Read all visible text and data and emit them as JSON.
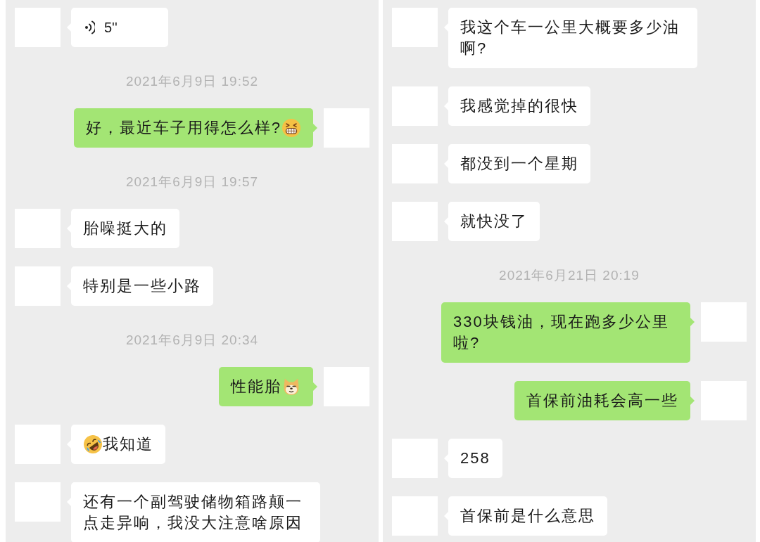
{
  "panels": [
    {
      "messages": [
        {
          "kind": "voice",
          "outgoing": false,
          "duration": "5''"
        },
        {
          "kind": "timestamp",
          "text": "2021年6月9日 19:52"
        },
        {
          "kind": "text",
          "outgoing": true,
          "content": [
            {
              "kind": "text",
              "text": "好，最近车子用得怎么样?"
            },
            {
              "kind": "grin"
            }
          ]
        },
        {
          "kind": "timestamp",
          "text": "2021年6月9日 19:57"
        },
        {
          "kind": "text",
          "outgoing": false,
          "content": [
            {
              "kind": "text",
              "text": "胎噪挺大的"
            }
          ]
        },
        {
          "kind": "text",
          "outgoing": false,
          "content": [
            {
              "kind": "text",
              "text": "特别是一些小路"
            }
          ]
        },
        {
          "kind": "timestamp",
          "text": "2021年6月9日 20:34"
        },
        {
          "kind": "text",
          "outgoing": true,
          "content": [
            {
              "kind": "text",
              "text": "性能胎"
            },
            {
              "kind": "doge"
            }
          ]
        },
        {
          "kind": "text",
          "outgoing": false,
          "content": [
            {
              "kind": "laugh"
            },
            {
              "kind": "text",
              "text": "我知道"
            }
          ]
        },
        {
          "kind": "text",
          "outgoing": false,
          "content": [
            {
              "kind": "text",
              "text": "还有一个副驾驶储物箱路颠一点走异响，我没大注意啥原因"
            }
          ]
        }
      ]
    },
    {
      "messages": [
        {
          "kind": "text",
          "outgoing": false,
          "content": [
            {
              "kind": "text",
              "text": "我这个车一公里大概要多少油啊?"
            }
          ]
        },
        {
          "kind": "text",
          "outgoing": false,
          "content": [
            {
              "kind": "text",
              "text": "我感觉掉的很快"
            }
          ]
        },
        {
          "kind": "text",
          "outgoing": false,
          "content": [
            {
              "kind": "text",
              "text": "都没到一个星期"
            }
          ]
        },
        {
          "kind": "text",
          "outgoing": false,
          "content": [
            {
              "kind": "text",
              "text": "就快没了"
            }
          ]
        },
        {
          "kind": "timestamp",
          "text": "2021年6月21日 20:19"
        },
        {
          "kind": "text",
          "outgoing": true,
          "content": [
            {
              "kind": "text",
              "text": "330块钱油，现在跑多少公里啦?"
            }
          ]
        },
        {
          "kind": "text",
          "outgoing": true,
          "content": [
            {
              "kind": "text",
              "text": "首保前油耗会高一些"
            }
          ]
        },
        {
          "kind": "text",
          "outgoing": false,
          "content": [
            {
              "kind": "text",
              "text": "258"
            }
          ]
        },
        {
          "kind": "text",
          "outgoing": false,
          "content": [
            {
              "kind": "text",
              "text": "首保前是什么意思"
            }
          ]
        }
      ]
    }
  ]
}
